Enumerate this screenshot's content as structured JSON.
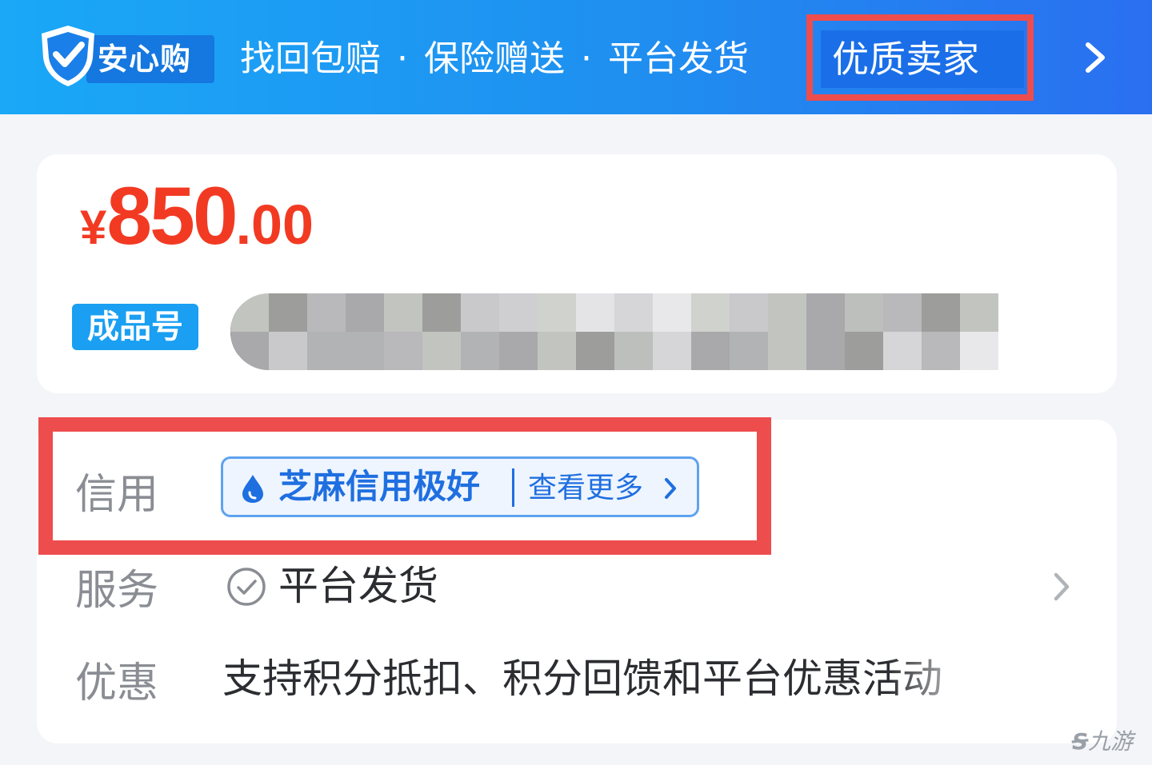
{
  "banner": {
    "brand": "安心购",
    "features": [
      "找回包赔",
      "保险赠送",
      "平台发货"
    ],
    "separator": "·",
    "seller": "优质卖家",
    "icons": [
      "shield-check-icon",
      "chevron-right-icon"
    ]
  },
  "price": {
    "currency": "¥",
    "integer": "850",
    "decimal": ".00",
    "color": "#f23a23"
  },
  "product": {
    "tag": "成品号",
    "title_redacted": true
  },
  "details": {
    "credit": {
      "label": "信用",
      "badge": "芝麻信用极好",
      "more": "查看更多",
      "icons": [
        "drop-icon",
        "chevron-right-icon"
      ]
    },
    "service": {
      "label": "服务",
      "value": "平台发货",
      "icons": [
        "check-circle-icon",
        "chevron-right-icon"
      ]
    },
    "promo": {
      "label": "优惠",
      "value": "支持积分抵扣、积分回馈和平台优惠活动"
    }
  },
  "watermark": {
    "mark": "Ꞩ",
    "text": "九游"
  },
  "colors": {
    "banner_start": "#1aa8f7",
    "banner_end": "#2a6ff0",
    "highlight_box": "#ee4d4d",
    "credit_blue": "#1f6fe0",
    "tag_blue": "#1a9ff2"
  }
}
